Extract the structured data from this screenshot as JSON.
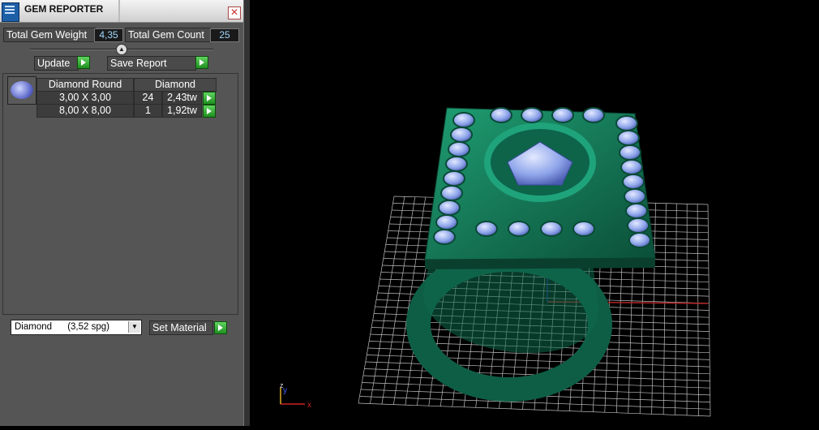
{
  "window": {
    "title": "GEM REPORTER"
  },
  "summary": {
    "weight_label": "Total Gem Weight",
    "weight_value": "4,35",
    "count_label": "Total Gem Count",
    "count_value": "25"
  },
  "toolbar": {
    "update_label": "Update",
    "save_label": "Save Report"
  },
  "gem_table": {
    "headers": [
      "Diamond Round",
      "Diamond"
    ],
    "rows": [
      {
        "size": "3,00 X 3,00",
        "count": "24",
        "weight": "2,43tw"
      },
      {
        "size": "8,00 X 8,00",
        "count": "1",
        "weight": "1,92tw"
      }
    ]
  },
  "material": {
    "selected": "Diamond      (3,52 spg)",
    "set_label": "Set Material"
  },
  "viewport": {
    "axis_x": "x",
    "axis_y": "y",
    "axis_z": "z",
    "model_color": "#157a5a",
    "gem_color": "#8fa6e8"
  }
}
